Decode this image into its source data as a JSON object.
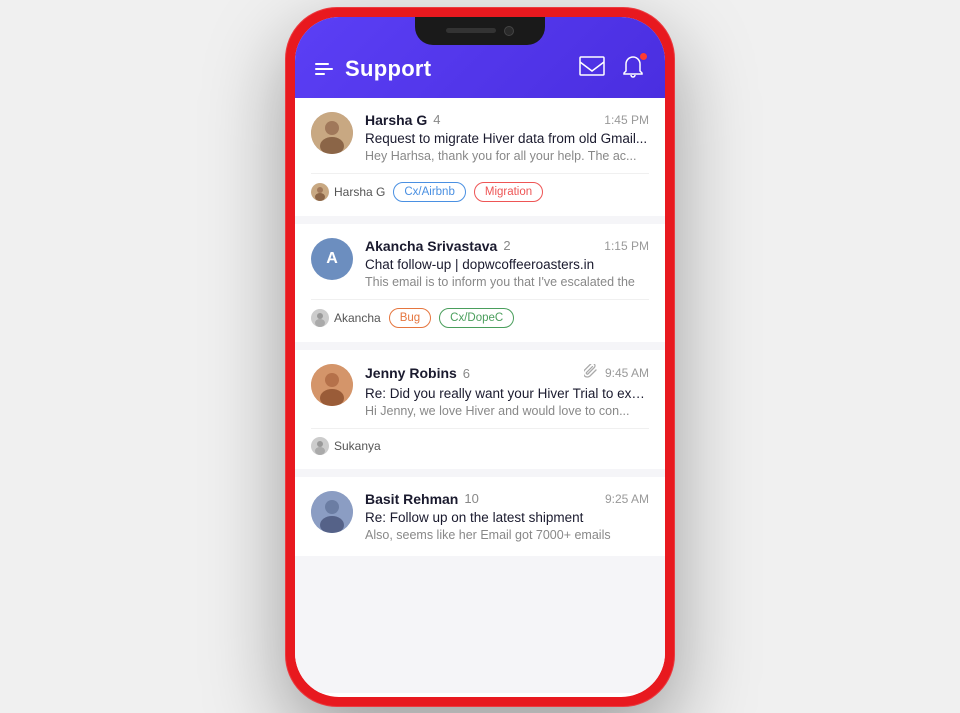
{
  "app": {
    "title": "Support"
  },
  "header": {
    "menu_label": "menu",
    "inbox_label": "inbox",
    "bell_label": "notifications",
    "has_notification": true
  },
  "conversations": [
    {
      "id": "conv-1",
      "name": "Harsha G",
      "count": "4",
      "time": "1:45 PM",
      "subject": "Request to migrate Hiver data from old Gmail...",
      "preview": "Hey Harhsa, thank you for all your help. The ac...",
      "assignee": "Harsha G",
      "tags": [
        "Cx/Airbnb",
        "Migration"
      ],
      "avatar_type": "photo",
      "avatar_letter": "H",
      "avatar_color": "#c8a882"
    },
    {
      "id": "conv-2",
      "name": "Akancha Srivastava",
      "count": "2",
      "time": "1:15 PM",
      "subject": "Chat follow-up | dopwcoffeeroasters.in",
      "preview": "This email is to inform you that I've escalated the",
      "assignee": "Akancha",
      "tags": [
        "Bug",
        "Cx/DopeC"
      ],
      "avatar_type": "letter",
      "avatar_letter": "A",
      "avatar_color": "#6c8ebf"
    },
    {
      "id": "conv-3",
      "name": "Jenny Robins",
      "count": "6",
      "time": "9:45 AM",
      "subject": "Re: Did you really want your Hiver Trial to expire?",
      "preview": "Hi Jenny, we love Hiver and would love to con...",
      "assignee": "Sukanya",
      "tags": [],
      "has_attachment": true,
      "avatar_type": "photo",
      "avatar_letter": "J",
      "avatar_color": "#d4956a"
    },
    {
      "id": "conv-4",
      "name": "Basit Rehman",
      "count": "10",
      "time": "9:25 AM",
      "subject": "Re: Follow up on the latest shipment",
      "preview": "Also, seems like her Email got 7000+ emails",
      "assignee": "",
      "tags": [],
      "avatar_type": "photo",
      "avatar_letter": "B",
      "avatar_color": "#8b9dc3"
    }
  ],
  "tags": {
    "cx_airbnb": "Cx/Airbnb",
    "migration": "Migration",
    "bug": "Bug",
    "cx_dopec": "Cx/DopeC"
  }
}
